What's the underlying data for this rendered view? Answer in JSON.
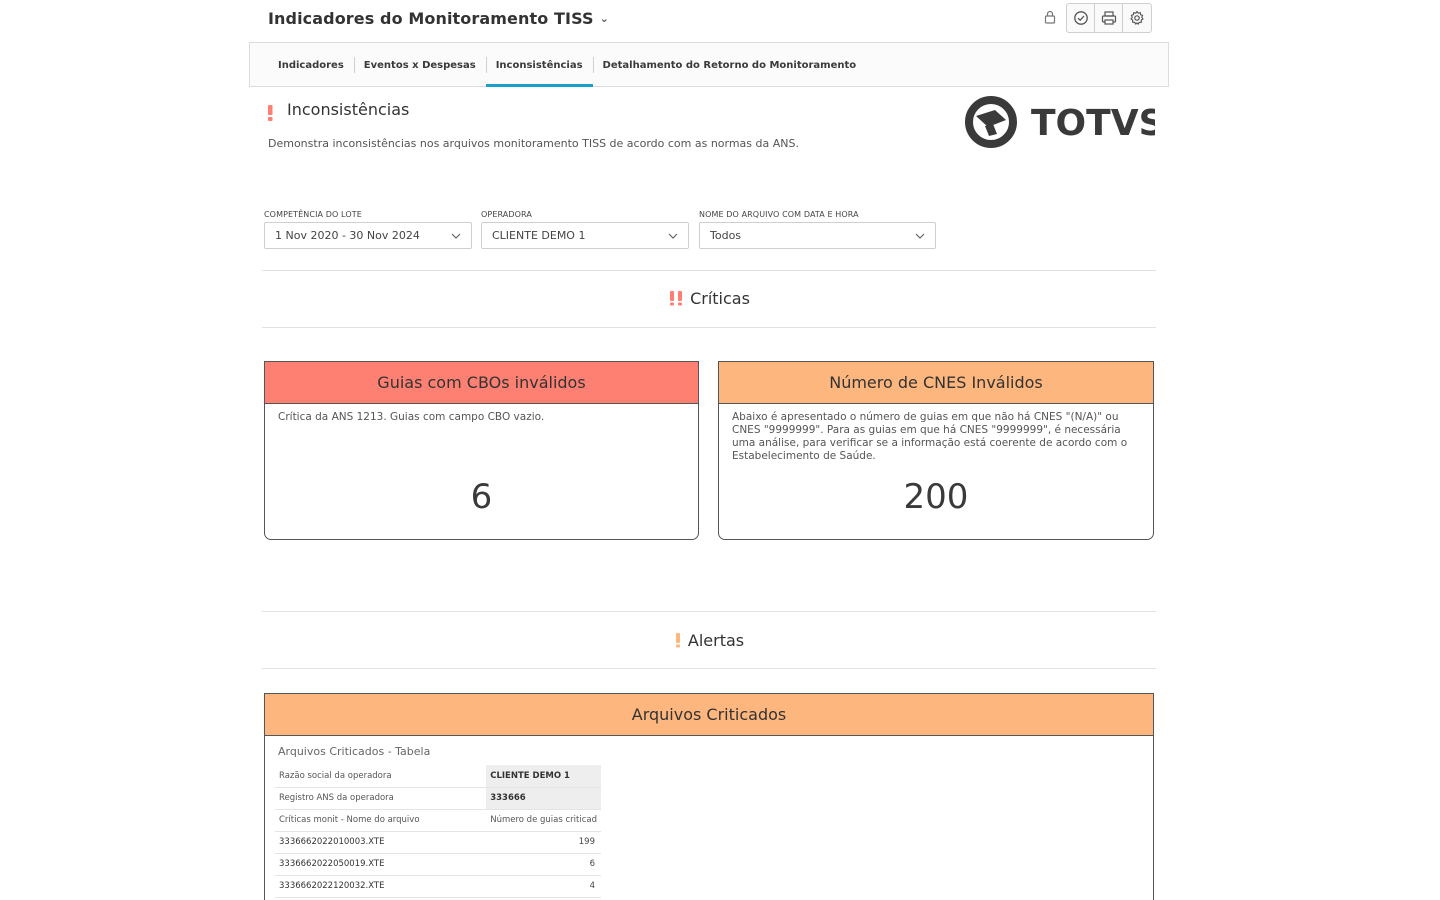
{
  "header": {
    "title": "Indicadores do Monitoramento TISS",
    "icons": [
      "lock-icon",
      "clock-icon",
      "print-icon",
      "gear-icon"
    ]
  },
  "tabs": [
    {
      "label": "Indicadores",
      "active": false
    },
    {
      "label": "Eventos x Despesas",
      "active": false
    },
    {
      "label": "Inconsistências",
      "active": true
    },
    {
      "label": "Detalhamento do Retorno do Monitoramento",
      "active": false
    }
  ],
  "section": {
    "title": "Inconsistências",
    "description": "Demonstra inconsistências nos arquivos monitoramento TISS de acordo com as normas da ANS.",
    "logo_text": "TOTVS"
  },
  "filters": [
    {
      "label": "COMPETÊNCIA DO LOTE",
      "value": "1 Nov 2020 - 30 Nov 2024"
    },
    {
      "label": "OPERADORA",
      "value": "CLIENTE DEMO 1"
    },
    {
      "label": "NOME DO ARQUIVO COM DATA E HORA",
      "value": "Todos"
    }
  ],
  "criticas": {
    "title": "Críticas",
    "cards": [
      {
        "title": "Guias com CBOs inválidos",
        "description": "Crítica da ANS 1213. Guias com campo CBO vazio.",
        "value": "6"
      },
      {
        "title": "Número de CNES Inválidos",
        "description": "Abaixo é apresentado o número de guias em que não há CNES \"(N/A)\" ou CNES \"9999999\". Para as guias em que há CNES \"9999999\", é necessária uma análise, para verificar se a informação está coerente de acordo com o Estabelecimento de Saúde.",
        "value": "200"
      }
    ]
  },
  "alertas": {
    "title": "Alertas",
    "table_card": {
      "title": "Arquivos Criticados",
      "subtitle": "Arquivos Criticados - Tabela",
      "meta": [
        {
          "label": "Razão social da operadora",
          "value": "CLIENTE DEMO 1"
        },
        {
          "label": "Registro ANS da operadora",
          "value": "333666"
        }
      ],
      "columns": [
        "Críticas monit - Nome do arquivo",
        "Número de guias criticad"
      ],
      "rows": [
        {
          "file": "3336662022010003.XTE",
          "count": "199"
        },
        {
          "file": "3336662022050019.XTE",
          "count": "6"
        },
        {
          "file": "3336662022120032.XTE",
          "count": "4"
        }
      ]
    }
  },
  "colors": {
    "accent_tab": "#1aa0c8",
    "critical": "#fd8072",
    "warning": "#fdb67d"
  }
}
